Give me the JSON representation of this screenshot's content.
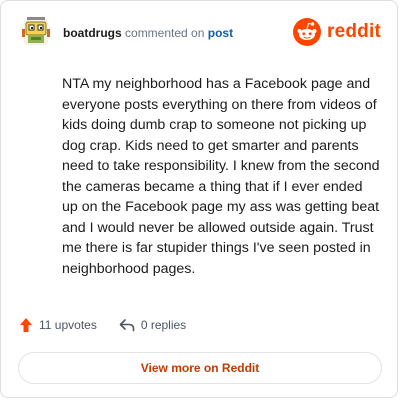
{
  "header": {
    "username": "boatdrugs",
    "action_text": "commented on",
    "post_link": "post"
  },
  "brand": {
    "name": "reddit",
    "color": "#ff4500",
    "icon": "reddit-snoo-icon"
  },
  "avatar": {
    "icon": "robot-avatar-icon"
  },
  "comment": {
    "text": "NTA my neighborhood has a Facebook page and everyone posts everything on there from videos of kids doing dumb crap to someone not picking up dog crap. Kids need to get smarter and parents need to take responsibility. I knew from the second the cameras became a thing that if I ever ended up on the Facebook page my ass was getting beat and I would never be allowed outside again. Trust me there is far stupider things I've seen posted in neighborhood pages."
  },
  "stats": {
    "upvotes": "11 upvotes",
    "upvote_icon": "upvote-arrow-icon",
    "upvote_color": "#ff4500",
    "replies": "0 replies",
    "reply_icon": "reply-arrow-icon"
  },
  "footer": {
    "view_more_label": "View more on Reddit"
  }
}
